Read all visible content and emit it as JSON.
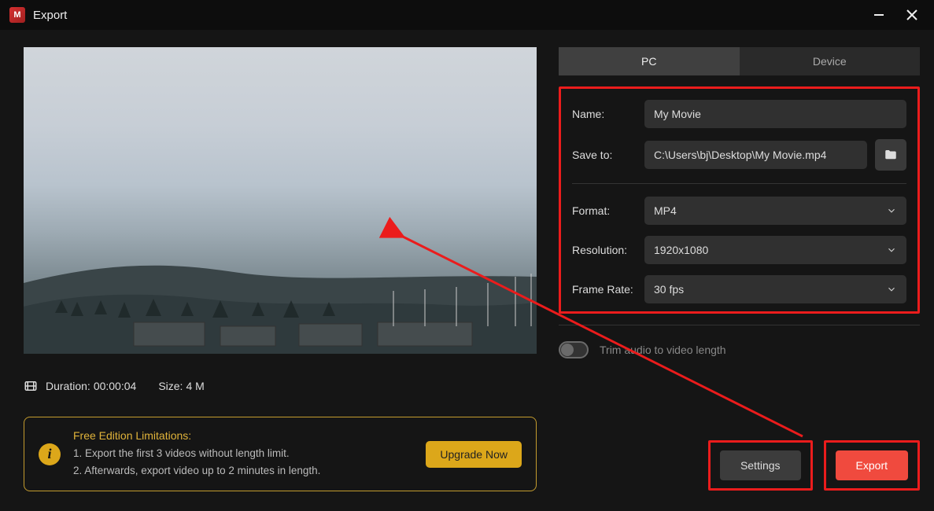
{
  "window": {
    "title": "Export"
  },
  "preview": {
    "duration_label": "Duration:",
    "duration_value": "00:00:04",
    "size_label": "Size:",
    "size_value": "4 M"
  },
  "limitations": {
    "title": "Free Edition Limitations:",
    "line1": "1. Export the first 3 videos without length limit.",
    "line2": "2. Afterwards, export video up to 2 minutes in length.",
    "upgrade": "Upgrade Now"
  },
  "tabs": {
    "pc": "PC",
    "device": "Device"
  },
  "form": {
    "name_label": "Name:",
    "name_value": "My Movie",
    "saveto_label": "Save to:",
    "saveto_value": "C:\\Users\\bj\\Desktop\\My Movie.mp4",
    "format_label": "Format:",
    "format_value": "MP4",
    "resolution_label": "Resolution:",
    "resolution_value": "1920x1080",
    "framerate_label": "Frame Rate:",
    "framerate_value": "30 fps"
  },
  "toggle": {
    "trim_label": "Trim audio to video length"
  },
  "actions": {
    "settings": "Settings",
    "export": "Export"
  },
  "colors": {
    "accent_red": "#eb1c1c",
    "accent_orange": "#f04a3e",
    "gold": "#dca71a"
  }
}
